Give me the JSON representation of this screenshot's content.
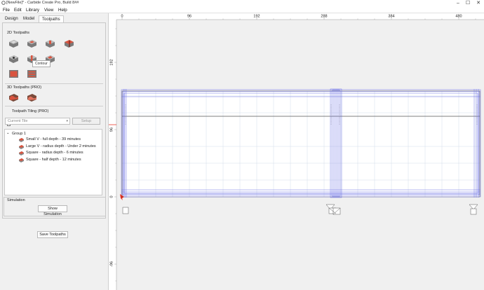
{
  "window": {
    "title": "[NewFile]* - Carbide Create Pro, Build 8##",
    "minimize": "–",
    "maximize": "☐",
    "close": "✕"
  },
  "menu": [
    "File",
    "Edit",
    "Library",
    "View",
    "Help"
  ],
  "tabs": [
    "Design",
    "Model",
    "Toolpaths"
  ],
  "active_tab": "Toolpaths",
  "toolpaths_2d_label": "2D Toolpaths",
  "tooltip": "Contour",
  "toolpaths_3d_label": "3D Toolpaths (PRO)",
  "tiling": {
    "label": "Toolpath Tiling (PRO)",
    "checked": false,
    "current_tile": "Current Tile",
    "setup_label": "Setup"
  },
  "tree": {
    "group_label": "Group 1",
    "items": [
      "Small V - full depth - 39 minutes",
      "Large V - radius depth - Under 2 minutes",
      "Square - radius depth - 6 minutes",
      "Square - half depth - 12 minutes"
    ]
  },
  "simulation": {
    "label": "Simulation",
    "show_button": "Show Simulation"
  },
  "save_button": "Save Toolpaths",
  "ruler": {
    "top_ticks": [
      "0",
      "96",
      "192",
      "288",
      "384",
      "480"
    ],
    "left_ticks": [
      "192",
      "96",
      "0",
      "-96"
    ]
  },
  "colors": {
    "toolpath_blue": "#6f73e6",
    "grid": "#c9d6e3",
    "origin_red": "#e8382a",
    "icon_red": "#d9543f"
  }
}
